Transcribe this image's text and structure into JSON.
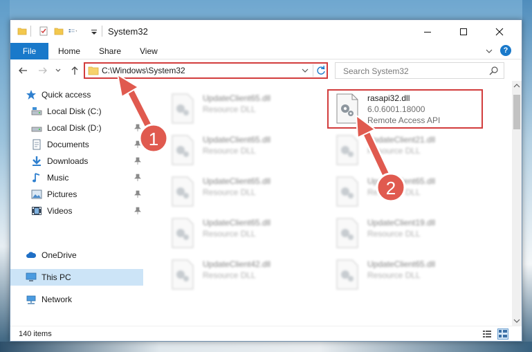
{
  "window": {
    "title": "System32",
    "controls": {
      "minimize": "minimize-icon",
      "maximize": "maximize-icon",
      "close": "close-icon"
    }
  },
  "ribbon": {
    "tabs": [
      "File",
      "Home",
      "Share",
      "View"
    ],
    "help": "?"
  },
  "navbar": {
    "address": "C:\\Windows\\System32",
    "search_placeholder": "Search System32"
  },
  "sidebar": {
    "items": [
      {
        "label": "Quick access",
        "icon": "star-icon",
        "level": 0,
        "pinned": false
      },
      {
        "label": "Local Disk (C:)",
        "icon": "drive-icon",
        "level": 1,
        "pinned": false
      },
      {
        "label": "Local Disk (D:)",
        "icon": "drive-icon",
        "level": 1,
        "pinned": true
      },
      {
        "label": "Documents",
        "icon": "documents-icon",
        "level": 1,
        "pinned": true
      },
      {
        "label": "Downloads",
        "icon": "download-icon",
        "level": 1,
        "pinned": true
      },
      {
        "label": "Music",
        "icon": "music-icon",
        "level": 1,
        "pinned": true
      },
      {
        "label": "Pictures",
        "icon": "pictures-icon",
        "level": 1,
        "pinned": true
      },
      {
        "label": "Videos",
        "icon": "videos-icon",
        "level": 1,
        "pinned": true
      },
      {
        "label": "OneDrive",
        "icon": "cloud-icon",
        "level": 0,
        "pinned": false
      },
      {
        "label": "This PC",
        "icon": "computer-icon",
        "level": 0,
        "pinned": false,
        "selected": true
      },
      {
        "label": "Network",
        "icon": "network-icon",
        "level": 0,
        "pinned": false
      }
    ]
  },
  "files": {
    "left_column": [
      {
        "name": "UpdateClient65.dll",
        "desc": "Resource DLL"
      },
      {
        "name": "UpdateClient65.dll",
        "desc": "Resource DLL"
      },
      {
        "name": "UpdateClient65.dll",
        "desc": "Resource DLL"
      },
      {
        "name": "UpdateClient65.dll",
        "desc": "Resource DLL"
      },
      {
        "name": "UpdateClient42.dll",
        "desc": "Resource DLL"
      }
    ],
    "right_column": [
      {
        "name": "rasapi32.dll",
        "version": "6.0.6001.18000",
        "desc": "Remote Access API",
        "highlighted": true
      },
      {
        "name": "UpdateClient21.dll",
        "desc": "Resource DLL"
      },
      {
        "name": "UpdateClient65.dll",
        "desc": "Resource DLL"
      },
      {
        "name": "UpdateClient19.dll",
        "desc": "Resource DLL"
      },
      {
        "name": "UpdateClient65.dll",
        "desc": "Resource DLL"
      }
    ]
  },
  "statusbar": {
    "count": "140 items"
  },
  "annotations": [
    {
      "label": "1",
      "color": "#e05a4f"
    },
    {
      "label": "2",
      "color": "#e05a4f"
    }
  ],
  "colors": {
    "accent": "#1979ca",
    "highlight": "#d23c3c",
    "selected": "#cce4f7"
  }
}
